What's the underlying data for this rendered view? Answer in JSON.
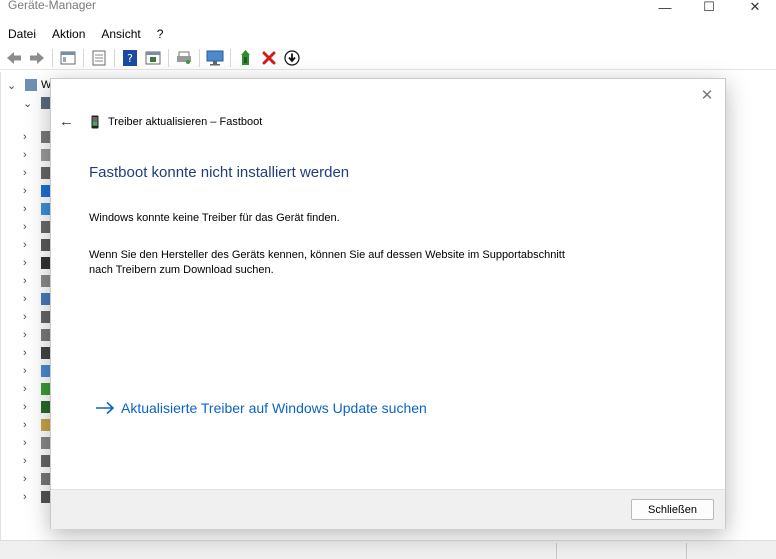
{
  "window": {
    "title": "Geräte-Manager",
    "minimize_glyph": "—",
    "maximize_glyph": "☐",
    "close_glyph": "✕"
  },
  "menu": {
    "items": [
      "Datei",
      "Aktion",
      "Ansicht",
      "?"
    ]
  },
  "toolbar": {
    "icons": [
      "back-icon",
      "forward-icon",
      "properties-icon",
      "scan-icon",
      "help-icon",
      "view-icon",
      "print-icon",
      "monitor-icon",
      "update-driver-icon",
      "uninstall-icon",
      "disable-icon"
    ],
    "colors": {
      "help": "#1a4ba3",
      "uninstall": "#d21c1c",
      "update_driver": "#2f8f2f"
    }
  },
  "tree": {
    "root_initial": "W",
    "expanded_child_icon": "computer-icon"
  },
  "dialog": {
    "back_glyph": "←",
    "close_glyph": "✕",
    "header_title": "Treiber aktualisieren – Fastboot",
    "heading": "Fastboot konnte nicht installiert werden",
    "paragraph1": "Windows konnte keine Treiber für das Gerät finden.",
    "paragraph2_line1": "Wenn Sie den Hersteller des Geräts kennen, können Sie auf dessen Website im Supportabschnitt",
    "paragraph2_line2": "nach Treibern zum Download suchen.",
    "link_text": "Aktualisierte Treiber auf Windows Update suchen",
    "close_button": "Schließen",
    "colors": {
      "heading": "#1f3f7a",
      "link": "#0b64c4"
    }
  }
}
